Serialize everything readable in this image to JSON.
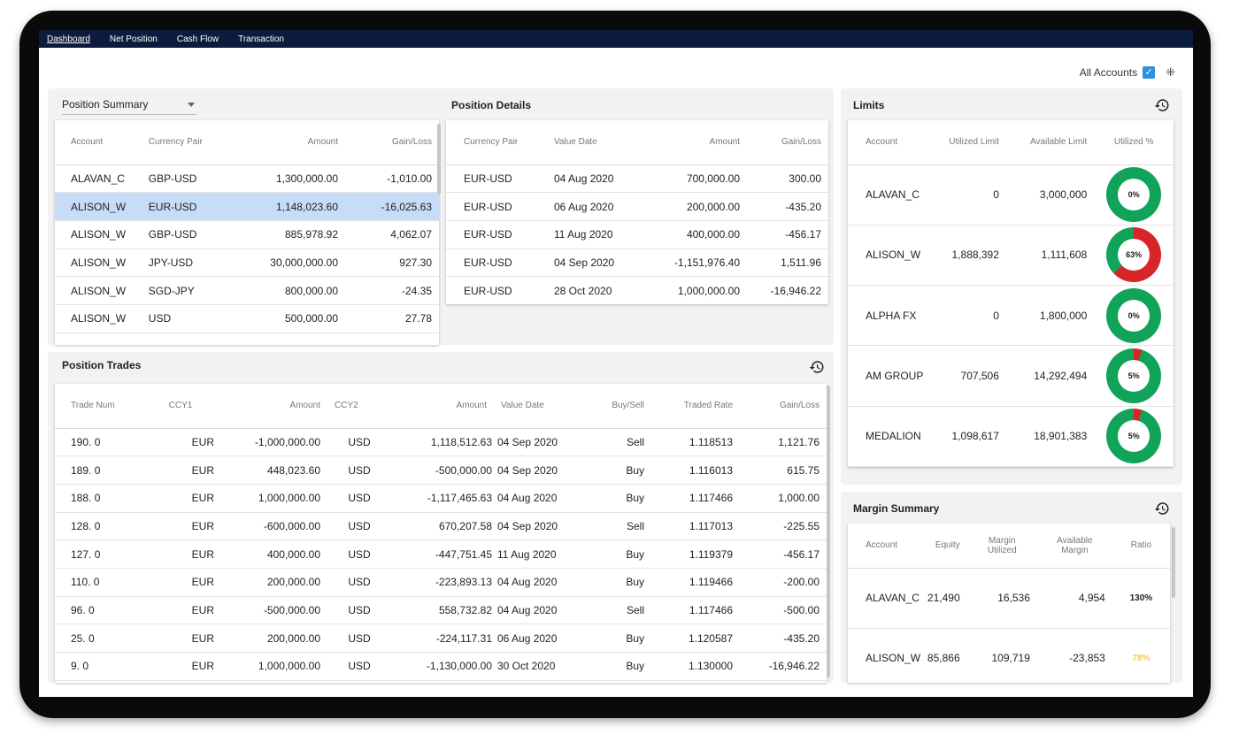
{
  "nav": {
    "items": [
      "Dashboard",
      "Net Position",
      "Cash Flow",
      "Transaction"
    ]
  },
  "accounts": {
    "label": "All Accounts"
  },
  "position_summary": {
    "title": "Position Summary",
    "headers": [
      "Account",
      "Currency Pair",
      "Amount",
      "Gain/Loss"
    ],
    "rows": [
      [
        "ALAVAN_C",
        "GBP-USD",
        "1,300,000.00",
        "-1,010.00"
      ],
      [
        "ALISON_W",
        "EUR-USD",
        "1,148,023.60",
        "-16,025.63"
      ],
      [
        "ALISON_W",
        "GBP-USD",
        "885,978.92",
        "4,062.07"
      ],
      [
        "ALISON_W",
        "JPY-USD",
        "30,000,000.00",
        "927.30"
      ],
      [
        "ALISON_W",
        "SGD-JPY",
        "800,000.00",
        "-24.35"
      ],
      [
        "ALISON_W",
        "USD",
        "500,000.00",
        "27.78"
      ]
    ]
  },
  "position_details": {
    "title": "Position Details",
    "headers": [
      "Currency Pair",
      "Value Date",
      "Amount",
      "Gain/Loss"
    ],
    "rows": [
      [
        "EUR-USD",
        "04 Aug 2020",
        "700,000.00",
        "300.00"
      ],
      [
        "EUR-USD",
        "06 Aug 2020",
        "200,000.00",
        "-435.20"
      ],
      [
        "EUR-USD",
        "11 Aug 2020",
        "400,000.00",
        "-456.17"
      ],
      [
        "EUR-USD",
        "04 Sep 2020",
        "-1,151,976.40",
        "1,511.96"
      ],
      [
        "EUR-USD",
        "28 Oct 2020",
        "1,000,000.00",
        "-16,946.22"
      ]
    ]
  },
  "position_trades": {
    "title": "Position Trades",
    "headers": [
      "Trade Num",
      "CCY1",
      "Amount",
      "CCY2",
      "Amount",
      "Value Date",
      "Buy/Sell",
      "Traded Rate",
      "Gain/Loss"
    ],
    "rows": [
      [
        "190. 0",
        "EUR",
        "-1,000,000.00",
        "USD",
        "1,118,512.63",
        "04 Sep 2020",
        "Sell",
        "1.118513",
        "1,121.76"
      ],
      [
        "189. 0",
        "EUR",
        "448,023.60",
        "USD",
        "-500,000.00",
        "04 Sep 2020",
        "Buy",
        "1.116013",
        "615.75"
      ],
      [
        "188. 0",
        "EUR",
        "1,000,000.00",
        "USD",
        "-1,117,465.63",
        "04 Aug 2020",
        "Buy",
        "1.117466",
        "1,000.00"
      ],
      [
        "128. 0",
        "EUR",
        "-600,000.00",
        "USD",
        "670,207.58",
        "04 Sep 2020",
        "Sell",
        "1.117013",
        "-225.55"
      ],
      [
        "127. 0",
        "EUR",
        "400,000.00",
        "USD",
        "-447,751.45",
        "11 Aug 2020",
        "Buy",
        "1.119379",
        "-456.17"
      ],
      [
        "110. 0",
        "EUR",
        "200,000.00",
        "USD",
        "-223,893.13",
        "04 Aug 2020",
        "Buy",
        "1.119466",
        "-200.00"
      ],
      [
        "96. 0",
        "EUR",
        "-500,000.00",
        "USD",
        "558,732.82",
        "04 Aug 2020",
        "Sell",
        "1.117466",
        "-500.00"
      ],
      [
        "25. 0",
        "EUR",
        "200,000.00",
        "USD",
        "-224,117.31",
        "06 Aug 2020",
        "Buy",
        "1.120587",
        "-435.20"
      ],
      [
        "9. 0",
        "EUR",
        "1,000,000.00",
        "USD",
        "-1,130,000.00",
        "30 Oct 2020",
        "Buy",
        "1.130000",
        "-16,946.22"
      ]
    ]
  },
  "limits": {
    "title": "Limits",
    "headers": [
      "Account",
      "Utilized Limit",
      "Available Limit",
      "Utilized %"
    ],
    "rows": [
      {
        "account": "ALAVAN_C",
        "utilized": "0",
        "available": "3,000,000",
        "pct_label": "0%",
        "pct": 0
      },
      {
        "account": "ALISON_W",
        "utilized": "1,888,392",
        "available": "1,111,608",
        "pct_label": "63%",
        "pct": 63
      },
      {
        "account": "ALPHA FX",
        "utilized": "0",
        "available": "1,800,000",
        "pct_label": "0%",
        "pct": 0
      },
      {
        "account": "AM GROUP",
        "utilized": "707,506",
        "available": "14,292,494",
        "pct_label": "5%",
        "pct": 5
      },
      {
        "account": "MEDALION",
        "utilized": "1,098,617",
        "available": "18,901,383",
        "pct_label": "5%",
        "pct": 5
      }
    ],
    "colors": {
      "ok": "#12a35a",
      "used": "#d8252a"
    }
  },
  "margin_summary": {
    "title": "Margin Summary",
    "headers": [
      "Account",
      "Equity",
      "Margin Utilized",
      "Available Margin",
      "Ratio"
    ],
    "rows": [
      {
        "account": "ALAVAN_C",
        "equity": "21,490",
        "utilized": "16,536",
        "available": "4,954",
        "ratio": "130%",
        "ratio_color": "#222222"
      },
      {
        "account": "ALISON_W",
        "equity": "85,866",
        "utilized": "109,719",
        "available": "-23,853",
        "ratio": "78%",
        "ratio_color": "#f2c94c"
      }
    ]
  }
}
